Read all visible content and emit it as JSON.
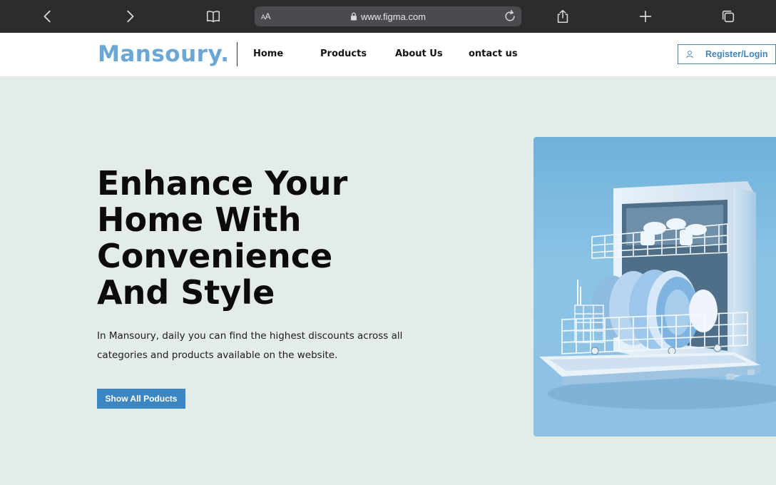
{
  "browser": {
    "url": "www.figma.com",
    "reader_label_small": "A",
    "reader_label_big": "A"
  },
  "header": {
    "brand": "Mansoury.",
    "nav": [
      "Home",
      "Products",
      "About Us",
      "ontact us"
    ],
    "login_label": "Register/Login"
  },
  "hero": {
    "title_lines": [
      "Enhance Your",
      "Home With",
      "Convenience",
      "And Style"
    ],
    "description_lines": [
      "In Mansoury, daily you can find the highest discounts across all",
      "categories and products available on the website."
    ],
    "cta_label": "Show All Poducts"
  },
  "colors": {
    "brand": "#6aa7d4",
    "accent": "#3c87c2",
    "background": "#e4ece9"
  }
}
